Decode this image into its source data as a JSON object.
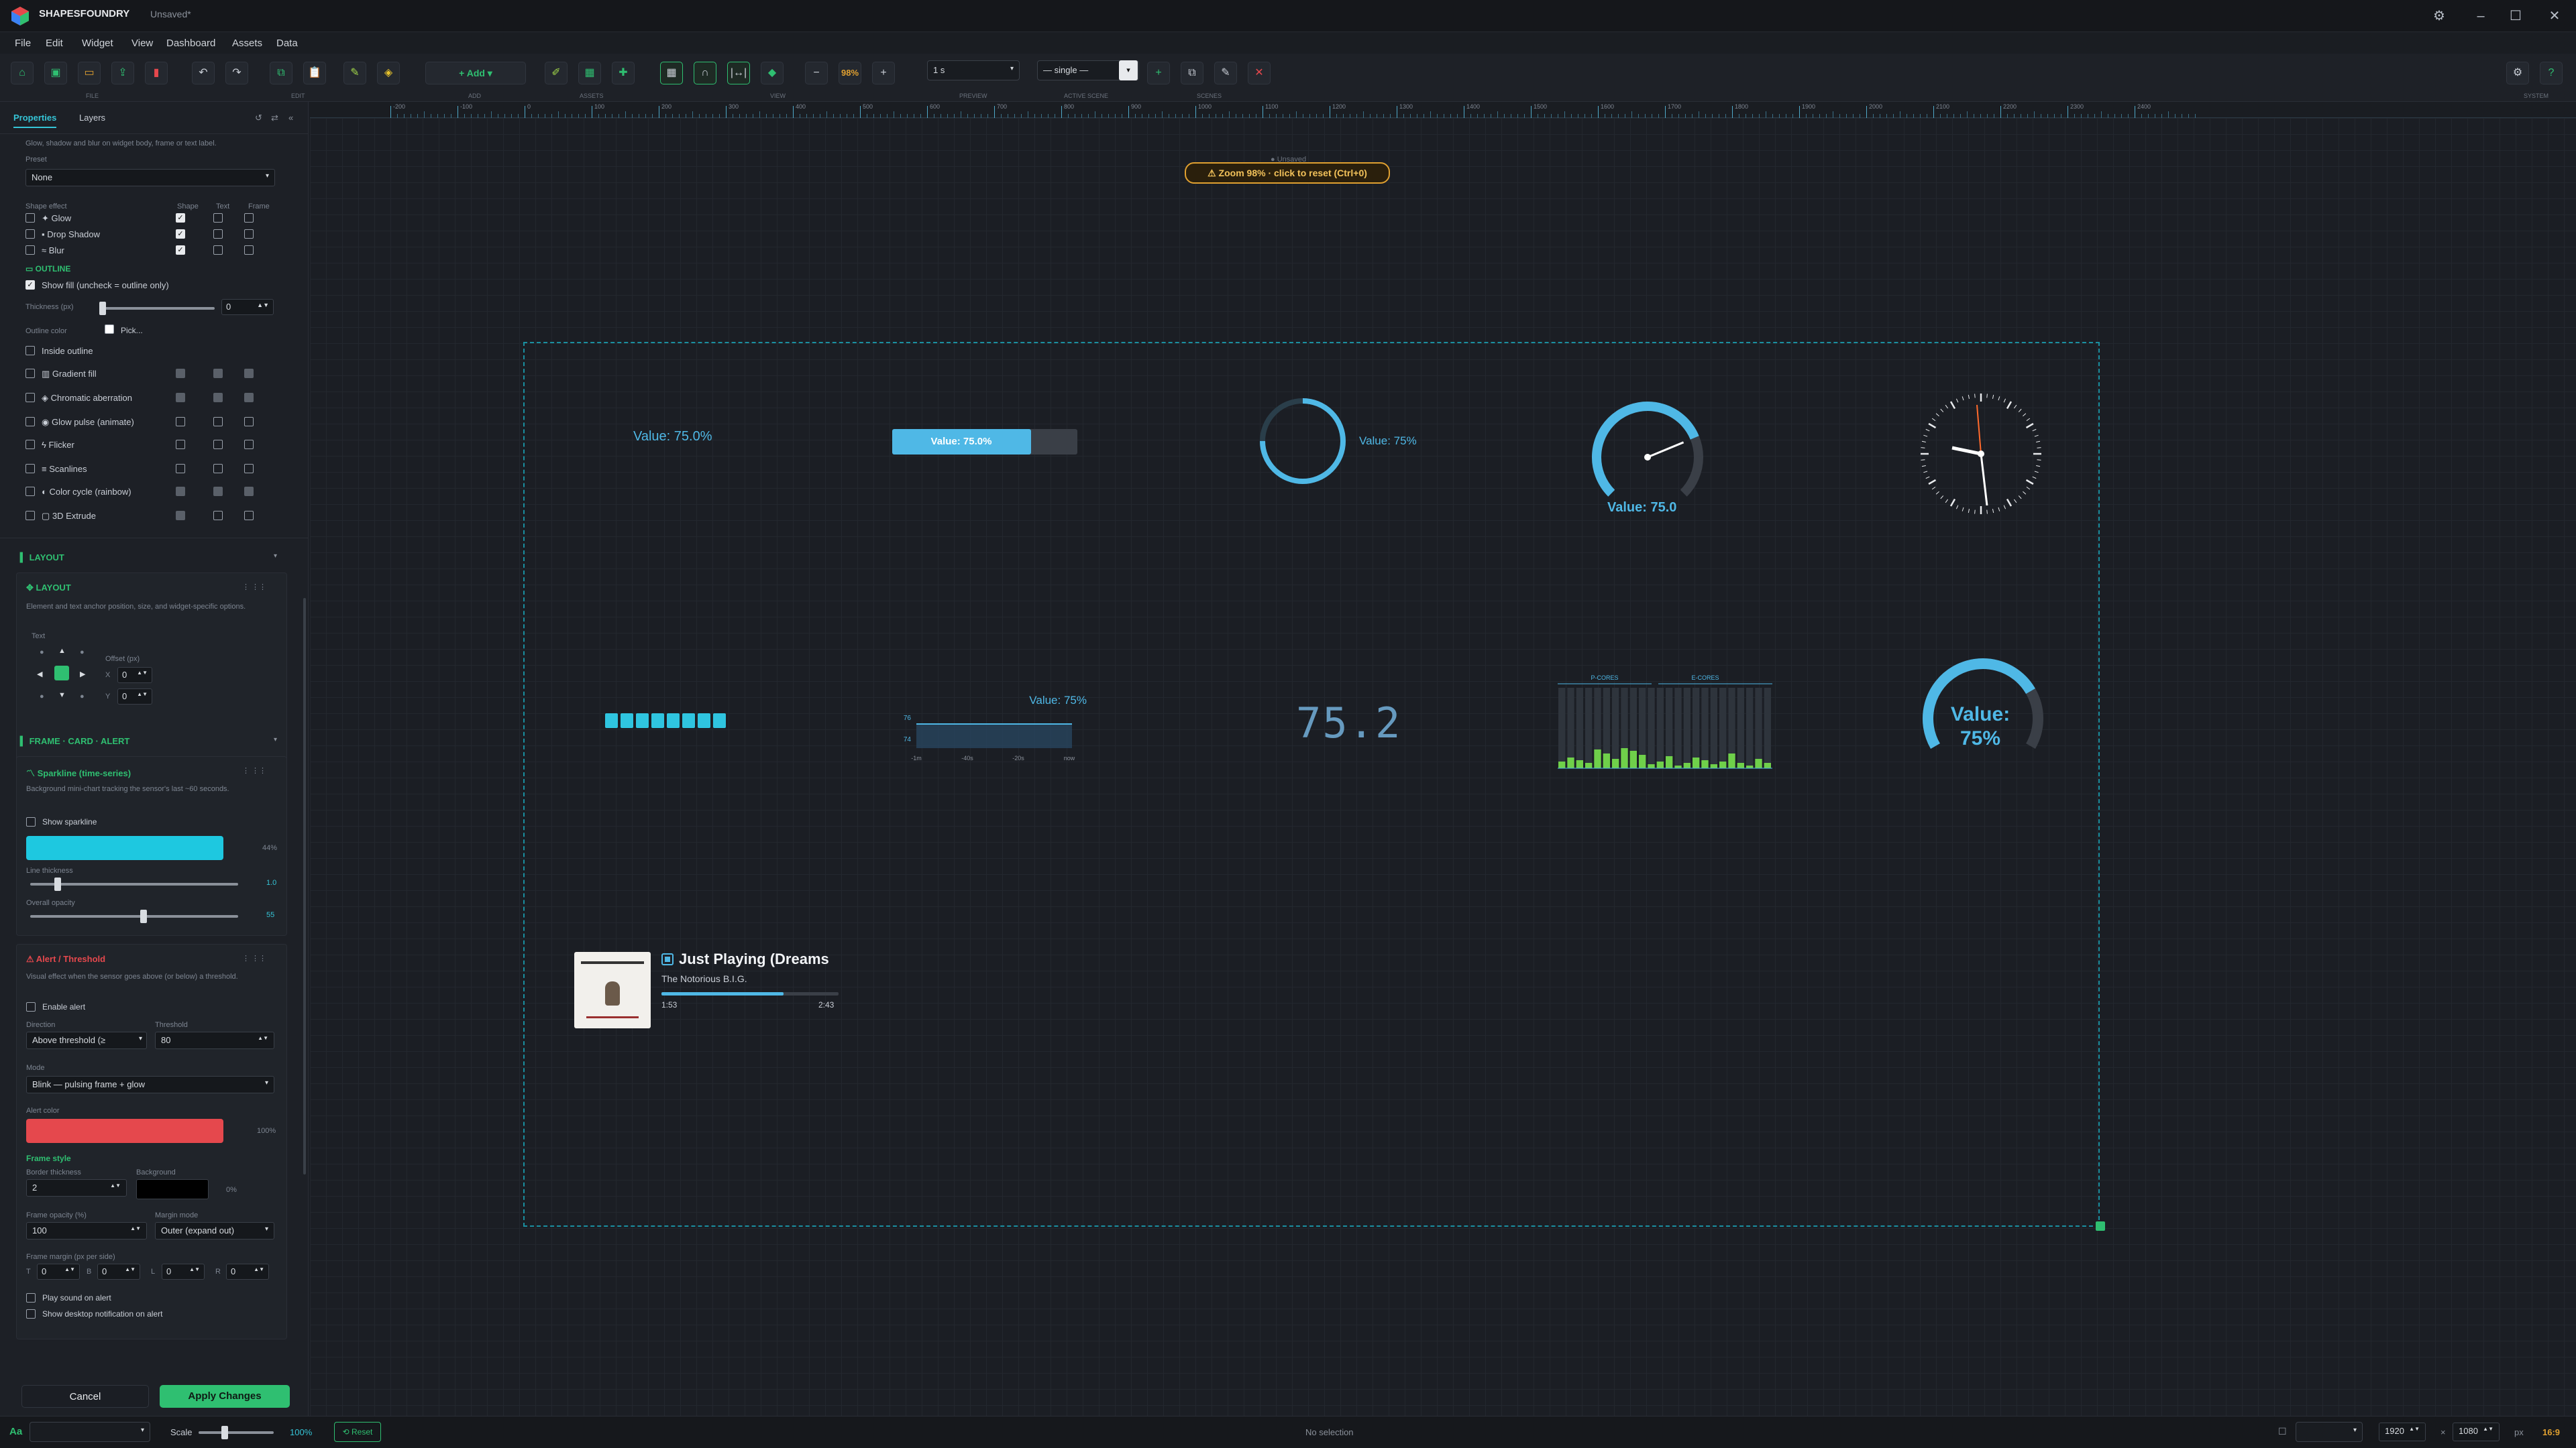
{
  "app": {
    "name": "SHAPESFOUNDRY",
    "document": "Unsaved*"
  },
  "menu": [
    "File",
    "Edit",
    "Widget",
    "View",
    "Dashboard",
    "Assets",
    "Data"
  ],
  "toolbar": {
    "groups": [
      "FILE",
      "EDIT",
      "ASSETS",
      "VIEW",
      "PREVIEW",
      "ACTIVE SCENE",
      "SCENES",
      "SYSTEM"
    ],
    "add_label": "Add",
    "zoom": "98%",
    "preview_interval": "1 s",
    "scene": "— single —"
  },
  "sidebar": {
    "tabs": [
      "Properties",
      "Layers"
    ],
    "effects_desc": "Glow, shadow and blur on widget body, frame or text label.",
    "preset_label": "Preset",
    "preset_value": "None",
    "effect_cols": [
      "Shape effect",
      "Shape",
      "Text",
      "Frame"
    ],
    "effects": [
      "Glow",
      "Drop Shadow",
      "Blur"
    ],
    "outline_title": "OUTLINE",
    "show_fill": "Show fill (uncheck = outline only)",
    "thickness_label": "Thickness (px)",
    "thickness_value": "0",
    "outline_color_label": "Outline color",
    "pick_label": "Pick...",
    "inside_outline": "Inside outline",
    "extra_effects": [
      "Gradient fill",
      "Chromatic aberration",
      "Glow pulse (animate)",
      "Flicker",
      "Scanlines",
      "Color cycle (rainbow)",
      "3D Extrude"
    ],
    "layout_section": "LAYOUT",
    "layout_title": "LAYOUT",
    "layout_desc": "Element and text anchor position, size, and widget-specific options.",
    "text_label": "Text",
    "offset_label": "Offset (px)",
    "x_label": "X",
    "y_label": "Y",
    "x_value": "0",
    "y_value": "0",
    "fca_section": "FRAME · CARD · ALERT",
    "sparkline_title": "Sparkline (time-series)",
    "sparkline_desc": "Background mini-chart tracking the sensor's last ~60 seconds.",
    "show_sparkline": "Show sparkline",
    "sparkline_color": "#1ec8e0",
    "sparkline_pct": "44%",
    "line_thickness_label": "Line thickness",
    "line_thickness_value": "1.0",
    "overall_opacity_label": "Overall opacity",
    "overall_opacity_value": "55",
    "alert_title": "Alert / Threshold",
    "alert_desc": "Visual effect when the sensor goes above (or below) a threshold.",
    "enable_alert": "Enable alert",
    "direction_label": "Direction",
    "direction_value": "Above threshold (≥",
    "threshold_label": "Threshold",
    "threshold_value": "80",
    "mode_label": "Mode",
    "mode_value": "Blink — pulsing frame + glow",
    "alert_color_label": "Alert color",
    "alert_color": "#e5484d",
    "alert_pct": "100%",
    "frame_style": "Frame style",
    "border_thickness_label": "Border thickness",
    "border_thickness_value": "2",
    "background_label": "Background",
    "background_pct": "0%",
    "frame_opacity_label": "Frame opacity (%)",
    "frame_opacity_value": "100",
    "margin_mode_label": "Margin mode",
    "margin_mode_value": "Outer (expand out)",
    "frame_margin_label": "Frame margin (px per side)",
    "margins": [
      {
        "k": "T",
        "v": "0"
      },
      {
        "k": "B",
        "v": "0"
      },
      {
        "k": "L",
        "v": "0"
      },
      {
        "k": "R",
        "v": "0"
      }
    ],
    "play_sound": "Play sound on alert",
    "desktop_notif": "Show desktop notification on alert",
    "cancel": "Cancel",
    "apply": "Apply Changes"
  },
  "ruler_ticks": [
    "-200",
    "-100",
    "0",
    "100",
    "200",
    "300",
    "400",
    "500",
    "600",
    "700",
    "800",
    "900",
    "1000",
    "1100",
    "1200",
    "1300",
    "1400",
    "1500",
    "1600",
    "1700",
    "1800",
    "1900",
    "2000",
    "2100",
    "2200",
    "2300",
    "2400"
  ],
  "canvas": {
    "ghost_title": "Unsaved",
    "zoom_hint": "⚠ Zoom 98% · click to reset (Ctrl+0)",
    "w1": "Value: 75.0%",
    "w2": "Value: 75.0%",
    "w3": "Value: 75%",
    "w4": "Value: 75.0",
    "w7_label": "Value: 75%",
    "w7_y": [
      "76",
      "74"
    ],
    "w7_x": [
      "-1m",
      "-40s",
      "-20s",
      "now"
    ],
    "w8": "75.2",
    "w9_groups": [
      "P-CORES",
      "E-CORES"
    ],
    "w10": "Value:\n75%",
    "media_title": "Just Playing (Dreams",
    "media_artist": "The Notorious B.I.G.",
    "media_elapsed": "1:53",
    "media_total": "2:43",
    "level": 0.75
  },
  "statusbar": {
    "scale_label": "Scale",
    "scale_value": "100%",
    "reset": "⟲ Reset",
    "selection": "No selection",
    "width": "1920",
    "height": "1080",
    "unit": "px",
    "aspect": "16:9",
    "x": "×"
  },
  "colors": {
    "accent": "#2fbf71",
    "teal": "#35c4d6",
    "gauge": "#4fb8e6",
    "warn": "#e0a030",
    "alert": "#e5484d"
  }
}
